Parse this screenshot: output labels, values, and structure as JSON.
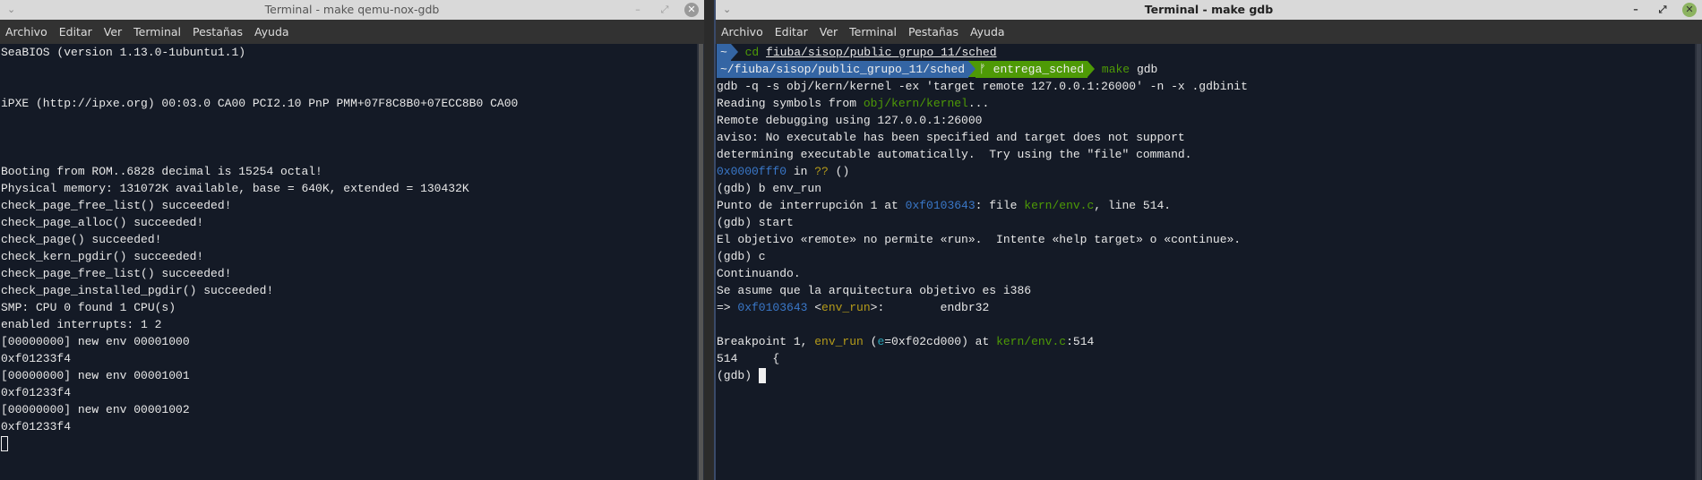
{
  "left": {
    "title": "Terminal - make qemu-nox-gdb",
    "menu": [
      "Archivo",
      "Editar",
      "Ver",
      "Terminal",
      "Pestañas",
      "Ayuda"
    ],
    "lines": [
      "SeaBIOS (version 1.13.0-1ubuntu1.1)",
      "",
      "",
      "iPXE (http://ipxe.org) 00:03.0 CA00 PCI2.10 PnP PMM+07F8C8B0+07ECC8B0 CA00",
      "",
      "",
      "",
      "Booting from ROM..6828 decimal is 15254 octal!",
      "Physical memory: 131072K available, base = 640K, extended = 130432K",
      "check_page_free_list() succeeded!",
      "check_page_alloc() succeeded!",
      "check_page() succeeded!",
      "check_kern_pgdir() succeeded!",
      "check_page_free_list() succeeded!",
      "check_page_installed_pgdir() succeeded!",
      "SMP: CPU 0 found 1 CPU(s)",
      "enabled interrupts: 1 2",
      "[00000000] new env 00001000",
      "0xf01233f4",
      "[00000000] new env 00001001",
      "0xf01233f4",
      "[00000000] new env 00001002",
      "0xf01233f4"
    ]
  },
  "right": {
    "title": "Terminal - make gdb",
    "menu": [
      "Archivo",
      "Editar",
      "Ver",
      "Terminal",
      "Pestañas",
      "Ayuda"
    ],
    "prompt1": {
      "dir": "~",
      "cmd": "cd",
      "arg": "fiuba/sisop/public_grupo_11/sched"
    },
    "prompt2": {
      "dir": "~/fiuba/sisop/public_grupo_11/sched",
      "branch_icon": "ᚠ",
      "branch": "entrega_sched",
      "cmd": "make",
      "arg": "gdb"
    },
    "l_gdbcmd": "gdb -q -s obj/kern/kernel -ex 'target remote 127.0.0.1:26000' -n -x .gdbinit",
    "l_read1": "Reading symbols from ",
    "l_read2": "obj/kern/kernel",
    "l_read3": "...",
    "l_remote": "Remote debugging using 127.0.0.1:26000",
    "l_aviso": "aviso: No executable has been specified and target does not support",
    "l_determ": "determining executable automatically.  Try using the \"file\" command.",
    "l_addr1": "0x0000fff0",
    "l_in": " in ",
    "l_qq": "??",
    "l_paren": " ()",
    "l_b": "(gdb) b env_run",
    "l_punto1": "Punto de interrupción 1 at ",
    "l_punto2": "0xf0103643",
    "l_punto3": ": file ",
    "l_punto4": "kern/env.c",
    "l_punto5": ", line 514.",
    "l_start": "(gdb) start",
    "l_obj": "El objetivo «remote» no permite «run».  Intente «help target» o «continue».",
    "l_c": "(gdb) c",
    "l_cont": "Continuando.",
    "l_arch": "Se asume que la arquitectura objetivo es i386",
    "l_arrow": "=> ",
    "l_addr2": "0xf0103643",
    "l_lt": " <",
    "l_fn": "env_run",
    "l_gt": ">:        endbr32",
    "l_bp1": "Breakpoint 1, ",
    "l_bp2": "env_run",
    "l_bp3": " (",
    "l_bp4": "e",
    "l_bp5": "=0xf02cd000) at ",
    "l_bp6": "kern/env.c",
    "l_bp7": ":514",
    "l_514": "514\t{",
    "l_prompt": "(gdb) "
  },
  "colors": {
    "bg": "#141a26",
    "prompt_blue": "#3465a4",
    "prompt_green": "#4e9a06",
    "addr": "#3a78c9",
    "func": "#b59b1a",
    "file": "#4e9a06"
  }
}
